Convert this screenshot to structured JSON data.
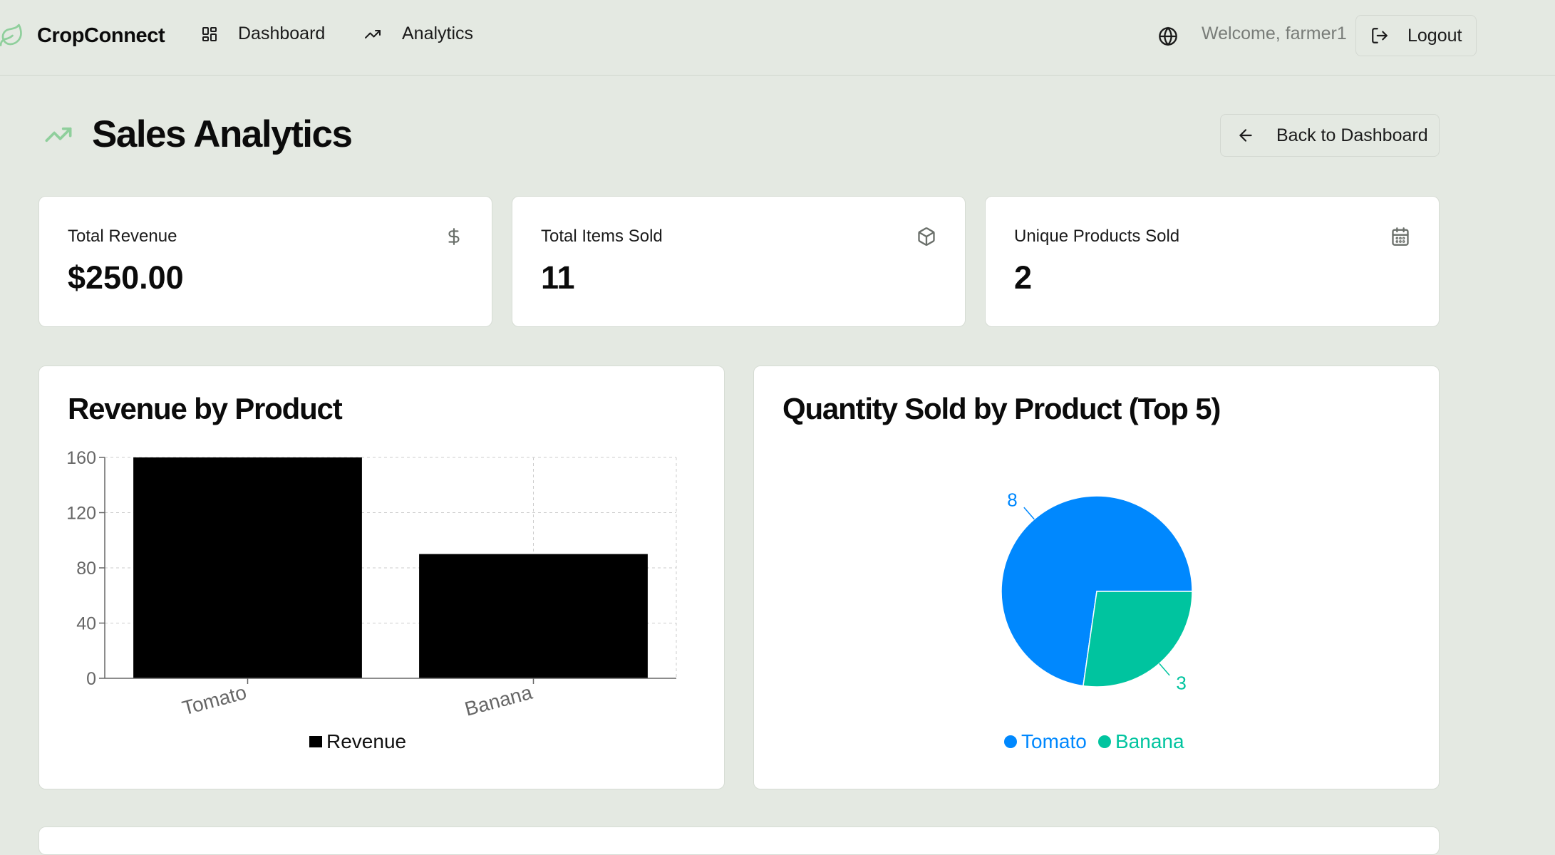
{
  "nav": {
    "brand": "CropConnect",
    "links": [
      "Dashboard",
      "Analytics"
    ],
    "welcome": "Welcome, farmer1",
    "logout": "Logout"
  },
  "page": {
    "title": "Sales Analytics",
    "back_button": "Back to Dashboard"
  },
  "stats": [
    {
      "title": "Total Revenue",
      "value": "$250.00",
      "icon": "dollar-icon"
    },
    {
      "title": "Total Items Sold",
      "value": "11",
      "icon": "package-icon"
    },
    {
      "title": "Unique Products Sold",
      "value": "2",
      "icon": "calendar-icon"
    }
  ],
  "colors": {
    "accent_green": "#8fcf9c",
    "bar_fill": "#000000",
    "pie_tomato": "#0088fe",
    "pie_banana": "#00c49f"
  },
  "chart_data": [
    {
      "type": "bar",
      "title": "Revenue by Product",
      "categories": [
        "Tomato",
        "Banana"
      ],
      "series": [
        {
          "name": "Revenue",
          "values": [
            160,
            90
          ]
        }
      ],
      "yticks": [
        "0",
        "40",
        "80",
        "120",
        "160"
      ],
      "ylim": [
        0,
        160
      ],
      "grid": true,
      "legend": "bottom"
    },
    {
      "type": "pie",
      "title": "Quantity Sold by Product (Top 5)",
      "categories": [
        "Tomato",
        "Banana"
      ],
      "values": [
        8,
        3
      ],
      "data_labels": [
        "8",
        "3"
      ],
      "legend": "bottom"
    }
  ]
}
